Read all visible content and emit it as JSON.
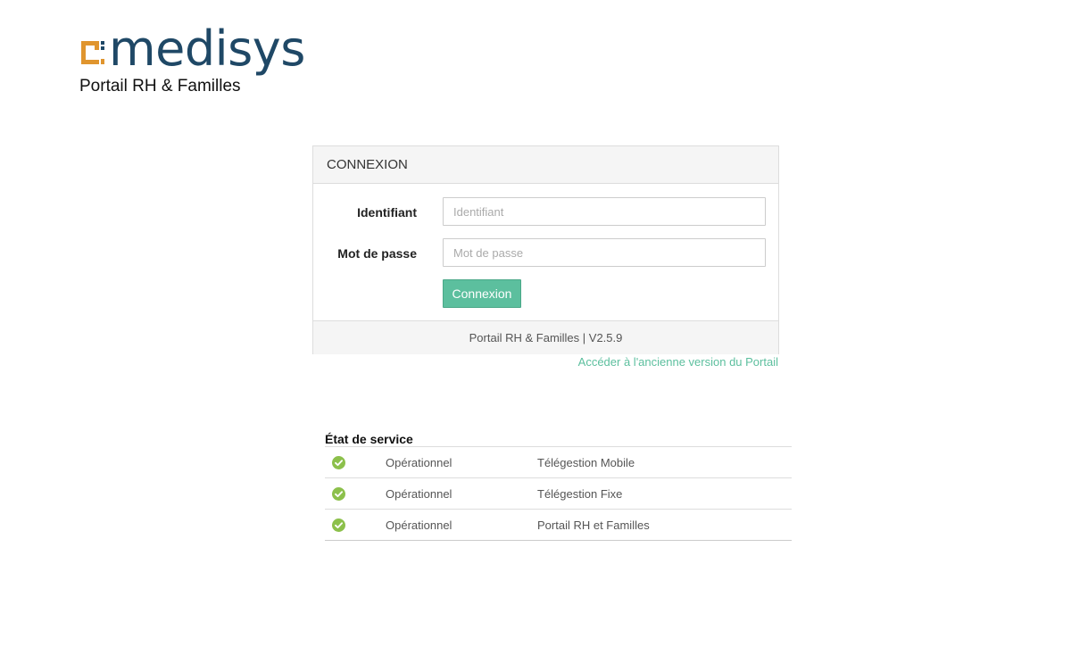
{
  "logo": {
    "wordmark": "medisys",
    "subtitle": "Portail RH & Familles",
    "mark_color": "#e0952e",
    "word_color": "#1f4866"
  },
  "login": {
    "heading": "CONNEXION",
    "identifiant_label": "Identifiant",
    "identifiant_placeholder": "Identifiant",
    "identifiant_value": "",
    "password_label": "Mot de passe",
    "password_placeholder": "Mot de passe",
    "password_value": "",
    "submit_label": "Connexion",
    "footer": "Portail RH & Familles | V2.5.9",
    "accent_color": "#5cbf9e"
  },
  "old_version_link": "Accéder à l'ancienne version du Portail",
  "service_status": {
    "title": "État de service",
    "rows": [
      {
        "icon": "check-circle-icon",
        "status": "Opérationnel",
        "service": "Télégestion Mobile"
      },
      {
        "icon": "check-circle-icon",
        "status": "Opérationnel",
        "service": "Télégestion Fixe"
      },
      {
        "icon": "check-circle-icon",
        "status": "Opérationnel",
        "service": "Portail RH et Familles"
      }
    ],
    "ok_color": "#8cc04b"
  }
}
